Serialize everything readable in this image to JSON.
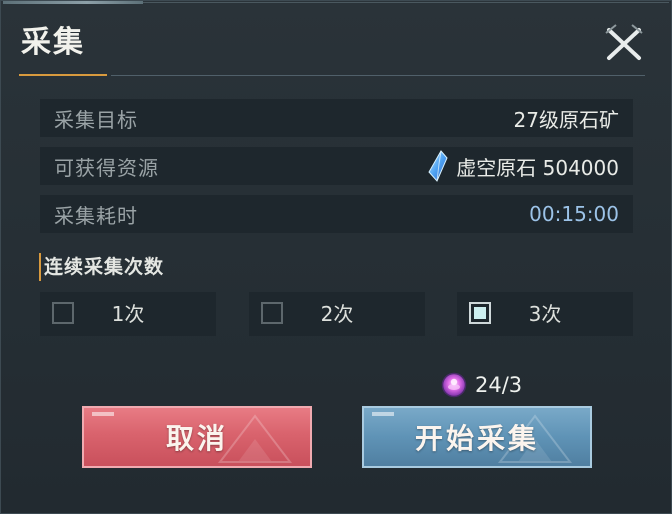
{
  "dialog": {
    "title": "采集"
  },
  "info_rows": [
    {
      "label": "采集目标",
      "value": "27级原石矿"
    },
    {
      "label": "可获得资源",
      "value": "虚空原石 504000",
      "icon": "crystal-icon"
    },
    {
      "label": "采集耗时",
      "value": "00:15:00"
    }
  ],
  "section": {
    "title": "连续采集次数"
  },
  "options": [
    {
      "label": "1次",
      "checked": false
    },
    {
      "label": "2次",
      "checked": false
    },
    {
      "label": "3次",
      "checked": true
    }
  ],
  "cost": {
    "icon": "purple-energy-icon",
    "value": "24/3"
  },
  "buttons": {
    "cancel_label": "取消",
    "start_label": "开始采集"
  },
  "colors": {
    "accent": "#d89a3e",
    "cancel_button": "#d9636d",
    "start_button": "#5f93b6",
    "time_value": "#9cc3e8"
  }
}
